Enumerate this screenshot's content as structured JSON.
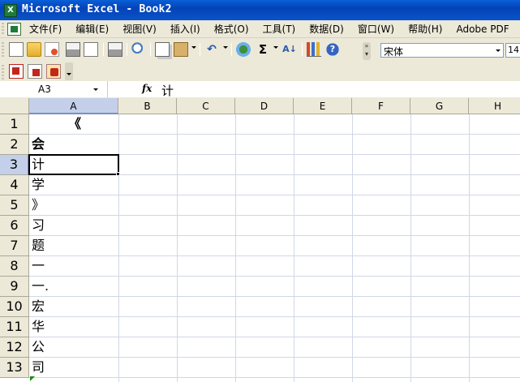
{
  "window": {
    "title": "Microsoft Excel - Book2"
  },
  "menu": {
    "items": [
      "文件(F)",
      "编辑(E)",
      "视图(V)",
      "插入(I)",
      "格式(O)",
      "工具(T)",
      "数据(D)",
      "窗口(W)",
      "帮助(H)",
      "Adobe PDF"
    ]
  },
  "toolbar": {
    "font_name": "宋体",
    "font_size": "14",
    "icons": [
      "new-icon",
      "open-icon",
      "permission-icon",
      "print-icon",
      "print-preview-icon",
      "research-icon",
      "copy-icon",
      "paste-icon",
      "undo-icon",
      "hyperlink-icon",
      "autosum-icon",
      "sort-icon",
      "chart-wizard-icon",
      "help-icon"
    ]
  },
  "pdf_toolbar": {
    "icons": [
      "convert-to-pdf-icon",
      "convert-and-email-icon",
      "convert-and-review-icon"
    ]
  },
  "formula_bar": {
    "name_box": "A3",
    "fx_label": "fx",
    "content": "计"
  },
  "sheet": {
    "columns": [
      "A",
      "B",
      "C",
      "D",
      "E",
      "F",
      "G",
      "H"
    ],
    "rows": [
      "1",
      "2",
      "3",
      "4",
      "5",
      "6",
      "7",
      "8",
      "9",
      "10",
      "11",
      "12",
      "13"
    ],
    "active_cell": "A3",
    "column_a": [
      "《",
      "会",
      "计",
      "学",
      "》",
      "习",
      "题",
      "一",
      "一.",
      "宏",
      "华",
      "公",
      "司"
    ]
  }
}
